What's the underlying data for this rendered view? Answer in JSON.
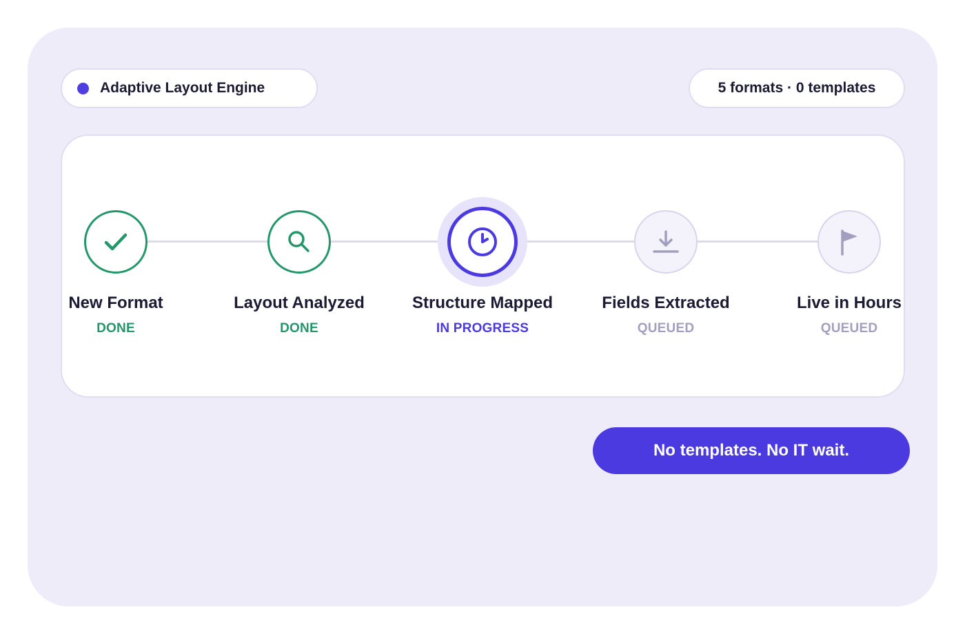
{
  "header": {
    "engine_label": "Adaptive Layout Engine",
    "stats_label": "5 formats · 0 templates"
  },
  "colors": {
    "accent": "#4a3adf",
    "done": "#23976a",
    "queued": "#a29fbe",
    "panel_background": "#eeecf9"
  },
  "steps": [
    {
      "title": "New Format",
      "status": "DONE",
      "state": "done",
      "icon": "check-icon"
    },
    {
      "title": "Layout Analyzed",
      "status": "DONE",
      "state": "done",
      "icon": "search-icon"
    },
    {
      "title": "Structure Mapped",
      "status": "IN PROGRESS",
      "state": "active",
      "icon": "clock-icon"
    },
    {
      "title": "Fields Extracted",
      "status": "QUEUED",
      "state": "queued",
      "icon": "download-icon"
    },
    {
      "title": "Live in Hours",
      "status": "QUEUED",
      "state": "queued",
      "icon": "flag-icon"
    }
  ],
  "cta": {
    "label": "No templates. No IT wait."
  }
}
